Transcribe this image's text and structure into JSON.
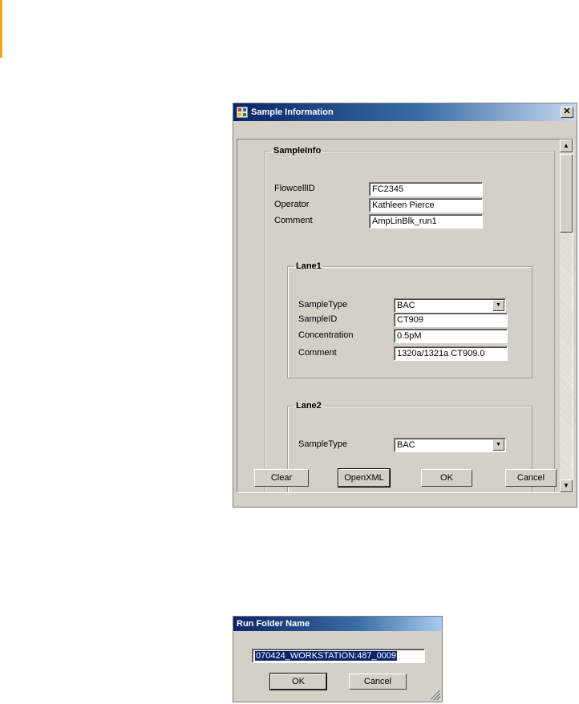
{
  "sample_dialog": {
    "title": "Sample Information",
    "close_glyph": "✕",
    "sampleinfo": {
      "legend": "SampleInfo",
      "flowcell_label": "FlowcellID",
      "flowcell_value": "FC2345",
      "operator_label": "Operator",
      "operator_value": "Kathleen Pierce",
      "comment_label": "Comment",
      "comment_value": "AmpLinBlk_run1"
    },
    "lane1": {
      "legend": "Lane1",
      "sampletype_label": "SampleType",
      "sampletype_value": "BAC",
      "sampleid_label": "SampleID",
      "sampleid_value": "CT909",
      "concentration_label": "Concentration",
      "concentration_value": "0.5pM",
      "comment_label": "Comment",
      "comment_value": "1320a/1321a CT909.0"
    },
    "lane2": {
      "legend": "Lane2",
      "sampletype_label": "SampleType",
      "sampletype_value": "BAC"
    },
    "buttons": {
      "clear": "Clear",
      "openxml": "OpenXML",
      "ok": "OK",
      "cancel": "Cancel"
    }
  },
  "run_folder_dialog": {
    "title": "Run Folder Name",
    "value": "070424_WORKSTATION:487_0009",
    "ok": "OK",
    "cancel": "Cancel"
  },
  "icons": {
    "scroll_up": "▲",
    "scroll_down": "▼",
    "dropdown": "▼"
  }
}
